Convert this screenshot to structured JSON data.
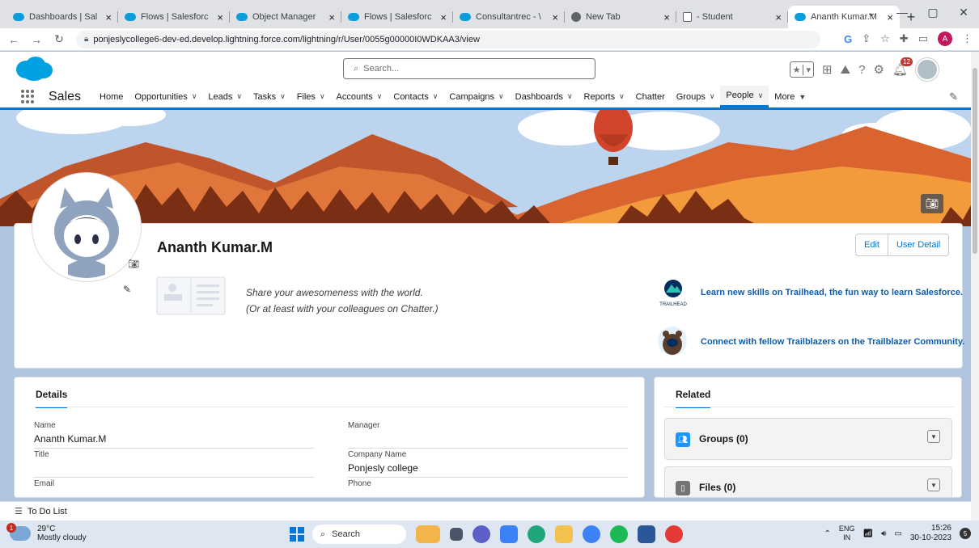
{
  "browser": {
    "tabs": [
      {
        "title": "Dashboards | Sal",
        "icon": "salesforce-icon",
        "active": false
      },
      {
        "title": "Flows | Salesforc",
        "icon": "salesforce-icon",
        "active": false
      },
      {
        "title": "Object Manager",
        "icon": "salesforce-icon",
        "active": false
      },
      {
        "title": "Flows | Salesforc",
        "icon": "salesforce-icon",
        "active": false
      },
      {
        "title": "Consultantrec - \\",
        "icon": "salesforce-icon",
        "active": false
      },
      {
        "title": "New Tab",
        "icon": "chrome-icon",
        "active": false
      },
      {
        "title": "- Student",
        "icon": "document-icon",
        "active": false
      },
      {
        "title": "Ananth Kumar.M",
        "icon": "salesforce-icon",
        "active": true
      }
    ],
    "new_tab": "+",
    "url": "ponjeslycollege6-dev-ed.develop.lightning.force.com/lightning/r/User/0055g00000I0WDKAA3/view",
    "profile_initial": "A"
  },
  "header": {
    "search_placeholder": "Search...",
    "notification_count": "12"
  },
  "nav": {
    "app_name": "Sales",
    "items": [
      {
        "label": "Home",
        "chevron": false
      },
      {
        "label": "Opportunities",
        "chevron": true
      },
      {
        "label": "Leads",
        "chevron": true
      },
      {
        "label": "Tasks",
        "chevron": true
      },
      {
        "label": "Files",
        "chevron": true
      },
      {
        "label": "Accounts",
        "chevron": true
      },
      {
        "label": "Contacts",
        "chevron": true
      },
      {
        "label": "Campaigns",
        "chevron": true
      },
      {
        "label": "Dashboards",
        "chevron": true
      },
      {
        "label": "Reports",
        "chevron": true
      },
      {
        "label": "Chatter",
        "chevron": false
      },
      {
        "label": "Groups",
        "chevron": true
      },
      {
        "label": "People",
        "chevron": true,
        "active": true
      },
      {
        "label": "More",
        "chevron": true
      }
    ]
  },
  "profile": {
    "name": "Ananth Kumar.M",
    "edit_label": "Edit",
    "user_detail_label": "User Detail",
    "share_line1": "Share your awesomeness with the world.",
    "share_line2": "(Or at least with your colleagues on Chatter.)",
    "trailhead_logo_text": "TRAILHEAD",
    "trailhead_link": "Learn new skills on Trailhead, the fun way to learn Salesforce.",
    "community_link": "Connect with fellow Trailblazers on the Trailblazer Community."
  },
  "details": {
    "header": "Details",
    "fields": [
      {
        "label": "Name",
        "value": "Ananth Kumar.M"
      },
      {
        "label": "Manager",
        "value": ""
      },
      {
        "label": "Title",
        "value": ""
      },
      {
        "label": "Company Name",
        "value": "Ponjesly college"
      },
      {
        "label": "Email",
        "value": ""
      },
      {
        "label": "Phone",
        "value": ""
      }
    ]
  },
  "related": {
    "header": "Related",
    "items": [
      {
        "label": "Groups (0)",
        "color": "#1b96ff"
      },
      {
        "label": "Files (0)",
        "color": "#747474"
      }
    ]
  },
  "utility": {
    "todo_label": "To Do List"
  },
  "taskbar": {
    "temperature": "29°C",
    "weather": "Mostly cloudy",
    "weather_badge": "1",
    "search_label": "Search",
    "lang_top": "ENG",
    "lang_bottom": "IN",
    "time": "15:26",
    "date": "30-10-2023",
    "notification_badge": "5"
  },
  "colors": {
    "brand_blue": "#0176d3",
    "link_blue": "#0b5cab"
  }
}
